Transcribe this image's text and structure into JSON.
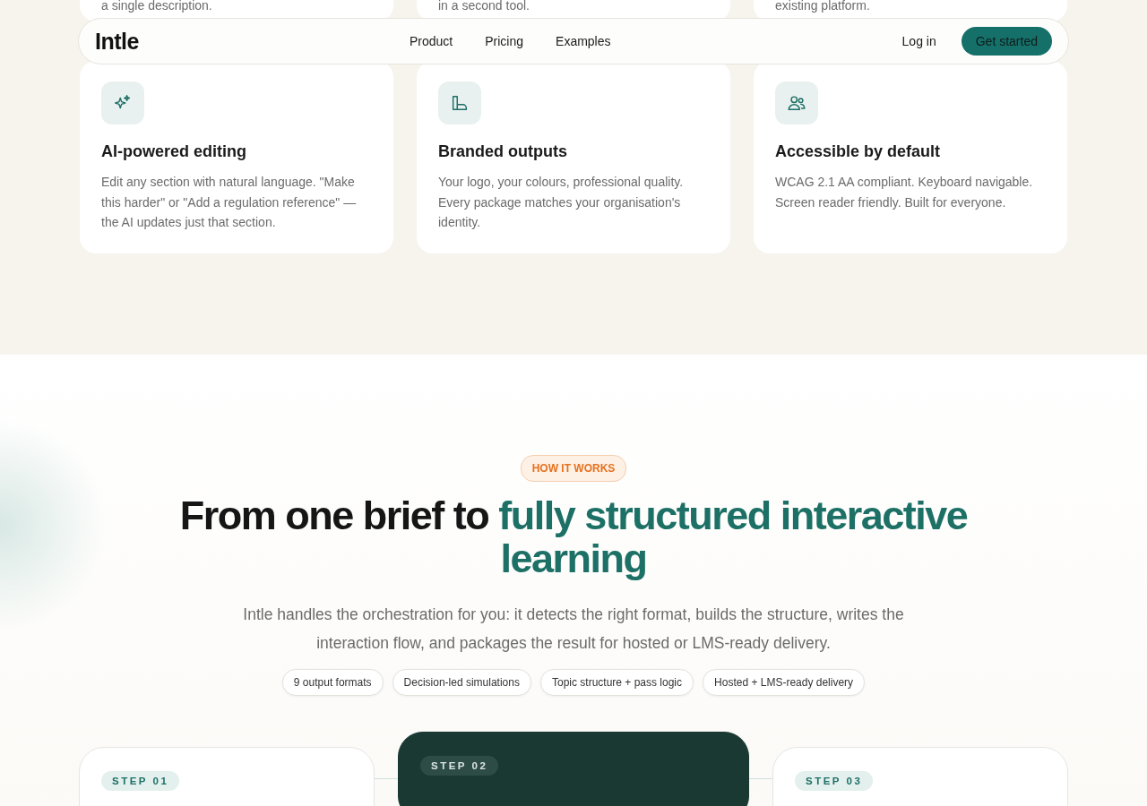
{
  "top_cards": [
    {
      "text": "a single description."
    },
    {
      "text": "in a second tool."
    },
    {
      "text": "existing platform."
    }
  ],
  "nav": {
    "logo": "Intle",
    "links": [
      "Product",
      "Pricing",
      "Examples"
    ],
    "login": "Log in",
    "cta": "Get started"
  },
  "features": [
    {
      "kind": "sparkles",
      "title": "AI-powered editing",
      "text": "Edit any section with natural language. \"Make this harder\" or \"Add a regulation reference\" — the AI updates just that section."
    },
    {
      "kind": "shape",
      "title": "Branded outputs",
      "text": "Your logo, your colours, professional quality. Every package matches your organisation's identity."
    },
    {
      "kind": "people",
      "title": "Accessible by default",
      "text": "WCAG 2.1 AA compliant. Keyboard navigable. Screen reader friendly. Built for everyone."
    }
  ],
  "how": {
    "badge": "HOW IT WORKS",
    "heading": "From one brief to",
    "heading_accent": "fully structured interactive learning",
    "intro": "Intle handles the orchestration for you: it detects the right format, builds the structure, writes the interaction flow, and packages the result for hosted or LMS-ready delivery.",
    "chips": [
      "9 output formats",
      "Decision-led simulations",
      "Topic structure + pass logic",
      "Hosted + LMS-ready delivery"
    ],
    "steps": [
      {
        "label": "STEP 01",
        "featured": false
      },
      {
        "label": "STEP 02",
        "featured": true
      },
      {
        "label": "STEP 03",
        "featured": false
      }
    ]
  }
}
